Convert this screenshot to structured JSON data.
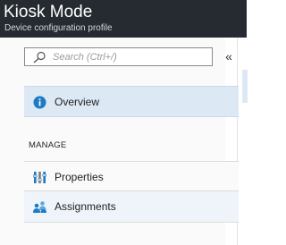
{
  "header": {
    "title": "Kiosk Mode",
    "subtitle": "Device configuration profile"
  },
  "search": {
    "placeholder": "Search (Ctrl+/)"
  },
  "collapse_glyph": "«",
  "nav": {
    "overview": "Overview",
    "section_manage": "MANAGE",
    "properties": "Properties",
    "assignments": "Assignments"
  },
  "colors": {
    "header_bg": "#252b31",
    "selected_bg": "#dce9f5",
    "accent": "#1f7ac4"
  }
}
